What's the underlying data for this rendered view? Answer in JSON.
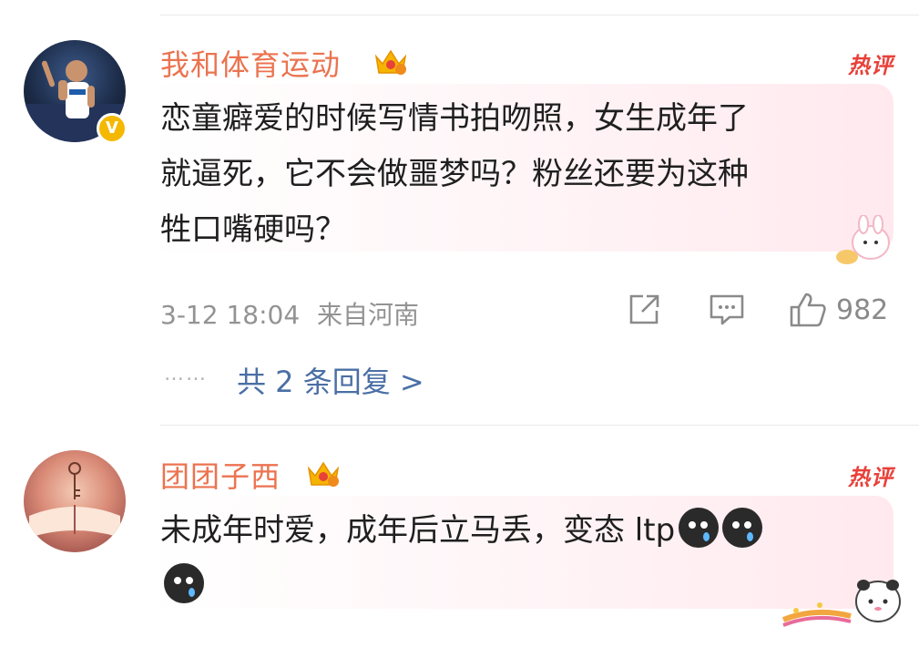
{
  "comments": [
    {
      "username": "我和体育运动",
      "hot_label": "热评",
      "verified_mark": "V",
      "content_lines": [
        "恋童癖爱的时候写情书拍吻照，女生成年了",
        "就逼死，它不会做噩梦吗？粉丝还要为这种",
        "牲口嘴硬吗？"
      ],
      "timestamp": "3-12 18:04",
      "location": "来自河南",
      "likes": "982",
      "replies_label": "共 2 条回复 >",
      "dots": "……"
    },
    {
      "username": "团团子西",
      "hot_label": "热评",
      "content_lines": [
        "未成年时爱，成年后立马丢，变态 ltp"
      ]
    }
  ],
  "icons": {
    "share": "share-icon",
    "comment": "comment-icon",
    "like": "thumbs-up-icon",
    "crown": "crown-level-icon",
    "emoji": "crying-emoji-icon"
  },
  "colors": {
    "username": "#eb7350",
    "hot": "#e8413a",
    "reply_link": "#4a6fa5",
    "meta": "#939393"
  }
}
